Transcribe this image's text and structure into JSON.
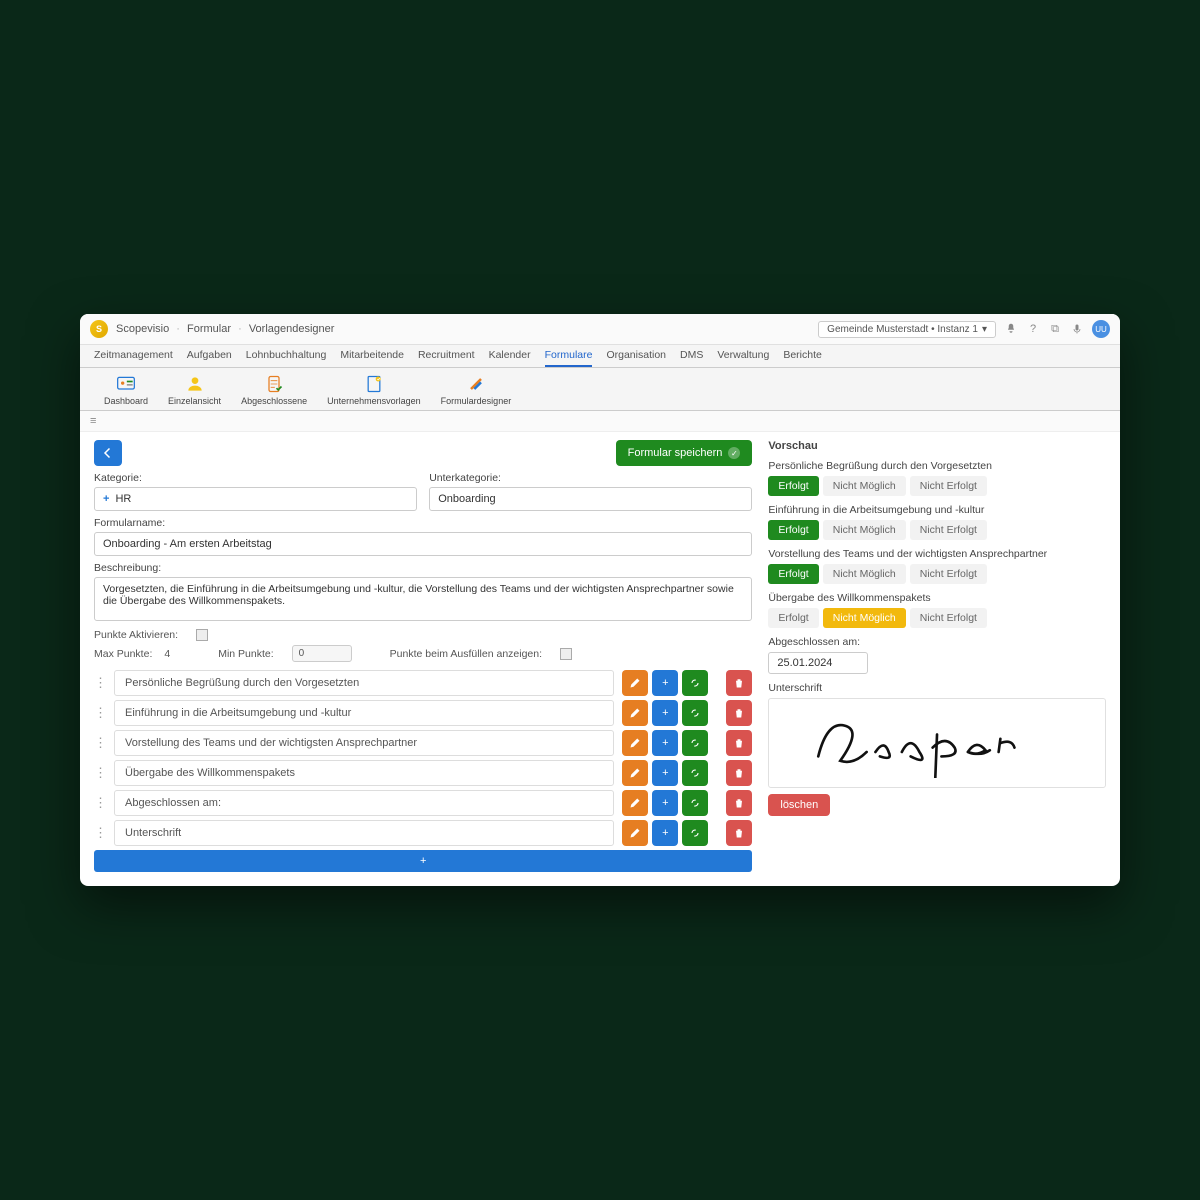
{
  "title": {
    "app": "Scopevisio",
    "crumb1": "Formular",
    "crumb2": "Vorlagendesigner"
  },
  "instance": "Gemeinde Musterstadt • Instanz 1",
  "mainnav": [
    "Zeitmanagement",
    "Aufgaben",
    "Lohnbuchhaltung",
    "Mitarbeitende",
    "Recruitment",
    "Kalender",
    "Formulare",
    "Organisation",
    "DMS",
    "Verwaltung",
    "Berichte"
  ],
  "ribbon": [
    "Dashboard",
    "Einzelansicht",
    "Abgeschlossene",
    "Unternehmensvorlagen",
    "Formulardesigner"
  ],
  "save_label": "Formular speichern",
  "labels": {
    "category": "Kategorie:",
    "subcategory": "Unterkategorie:",
    "formname": "Formularname:",
    "description": "Beschreibung:",
    "points_activate": "Punkte Aktivieren:",
    "max_points": "Max Punkte:",
    "min_points": "Min Punkte:",
    "show_points": "Punkte beim Ausfüllen anzeigen:"
  },
  "values": {
    "category": "HR",
    "subcategory": "Onboarding",
    "formname": "Onboarding - Am ersten Arbeitstag",
    "description": "Vorgesetzten, die Einführung in die Arbeitsumgebung und -kultur, die Vorstellung des Teams und der wichtigsten Ansprechpartner sowie die Übergabe des Willkommenspakets.",
    "max_points": "4",
    "min_points": "0"
  },
  "items": [
    "Persönliche Begrüßung durch den Vorgesetzten",
    "Einführung in die Arbeitsumgebung und -kultur",
    "Vorstellung des Teams und der wichtigsten Ansprechpartner",
    "Übergabe des Willkommenspakets",
    "Abgeschlossen am:",
    "Unterschrift"
  ],
  "preview": {
    "title": "Vorschau",
    "options": [
      "Erfolgt",
      "Nicht Möglich",
      "Nicht Erfolgt"
    ],
    "q1": "Persönliche Begrüßung durch den Vorgesetzten",
    "q2": "Einführung in die Arbeitsumgebung und -kultur",
    "q3": "Vorstellung des Teams und der wichtigsten Ansprechpartner",
    "q4": "Übergabe des Willkommenspakets",
    "date_label": "Abgeschlossen am:",
    "date_value": "25.01.2024",
    "sig_label": "Unterschrift",
    "delete": "löschen"
  }
}
